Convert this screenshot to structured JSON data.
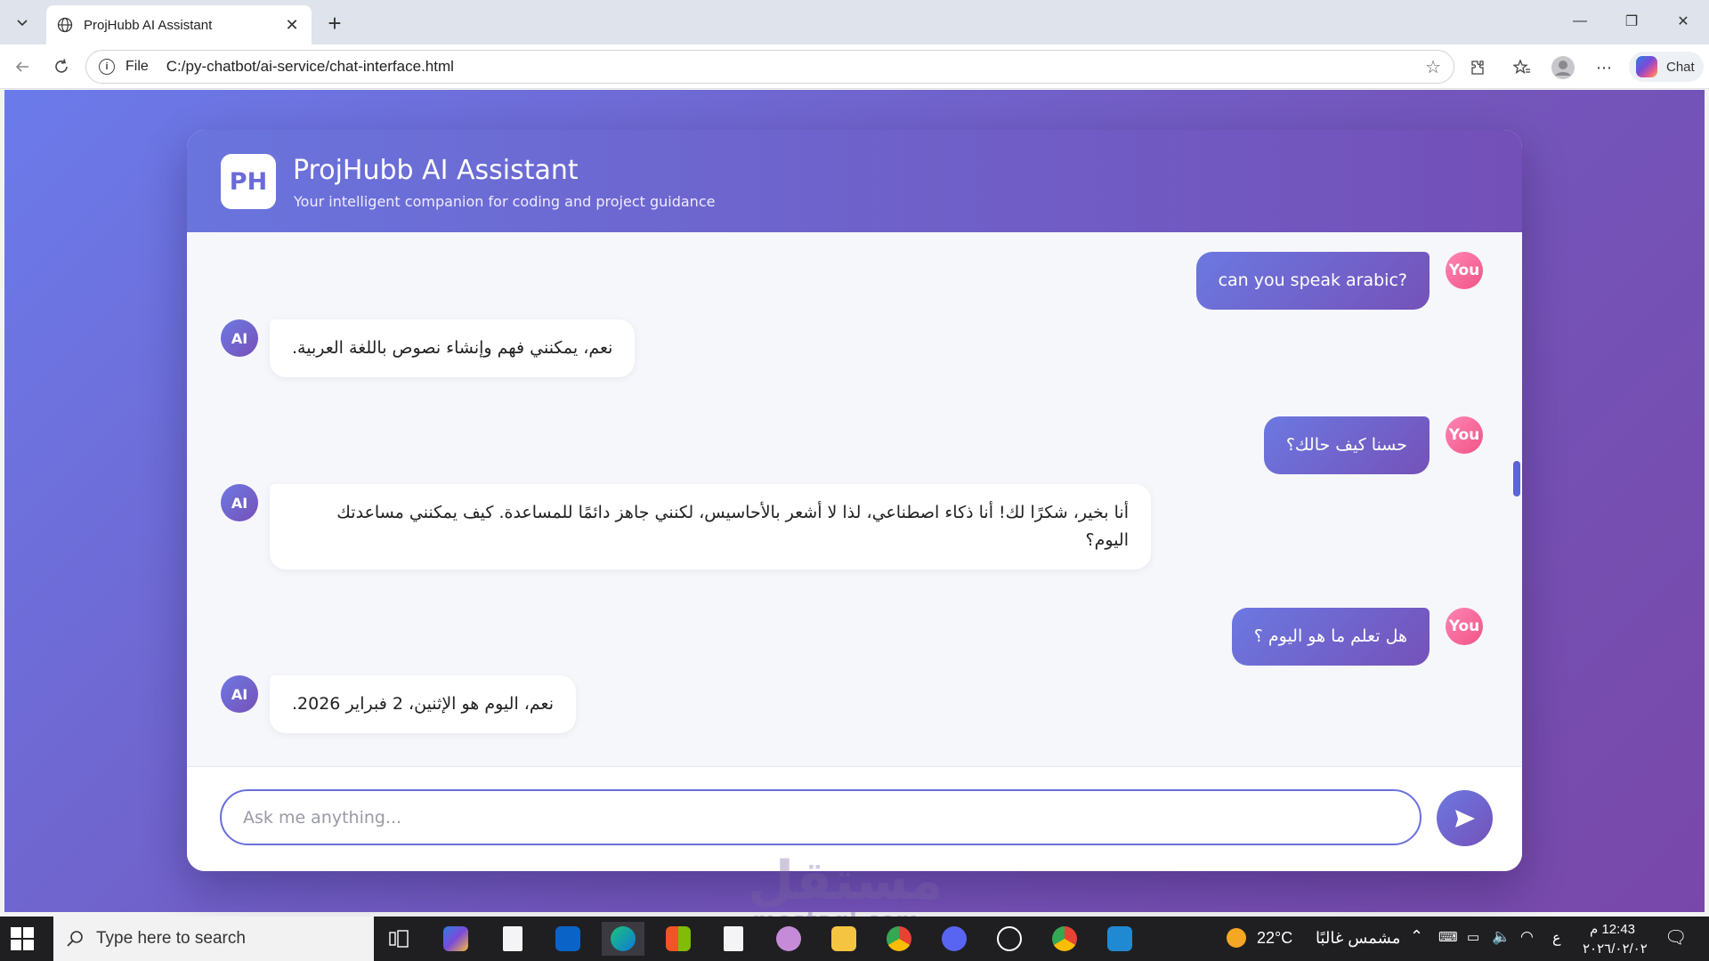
{
  "browser": {
    "tab_title": "ProjHubb AI Assistant",
    "address_scheme": "File",
    "address_url": "C:/py-chatbot/ai-service/chat-interface.html",
    "copilot_label": "Chat"
  },
  "chat": {
    "logo": "PH",
    "title": "ProjHubb AI Assistant",
    "subtitle": "Your intelligent companion for coding and project guidance",
    "user_label": "You",
    "ai_label": "AI",
    "messages": [
      {
        "role": "user",
        "text": "can you speak arabic?"
      },
      {
        "role": "ai",
        "text": "نعم، يمكنني فهم وإنشاء نصوص باللغة العربية."
      },
      {
        "role": "user",
        "text": "حسنا كيف حالك؟"
      },
      {
        "role": "ai",
        "text": "أنا بخير، شكرًا لك! أنا ذكاء اصطناعي، لذا لا أشعر بالأحاسيس، لكنني جاهز دائمًا للمساعدة. كيف يمكنني مساعدتك اليوم؟"
      },
      {
        "role": "user",
        "text": "هل تعلم ما هو اليوم ؟"
      },
      {
        "role": "ai",
        "text": "نعم، اليوم هو الإثنين، 2 فبراير 2026."
      }
    ],
    "input_placeholder": "Ask me anything...",
    "input_value": ""
  },
  "watermark": {
    "text": "مستقل",
    "sub": "mostaql.com"
  },
  "taskbar": {
    "search_placeholder": "Type here to search",
    "weather": "22°C",
    "weather_text": "مشمس غالبًا",
    "lang": "ع",
    "time": "12:43 م",
    "date": "٢٠٢٦/٠٢/٠٢"
  }
}
